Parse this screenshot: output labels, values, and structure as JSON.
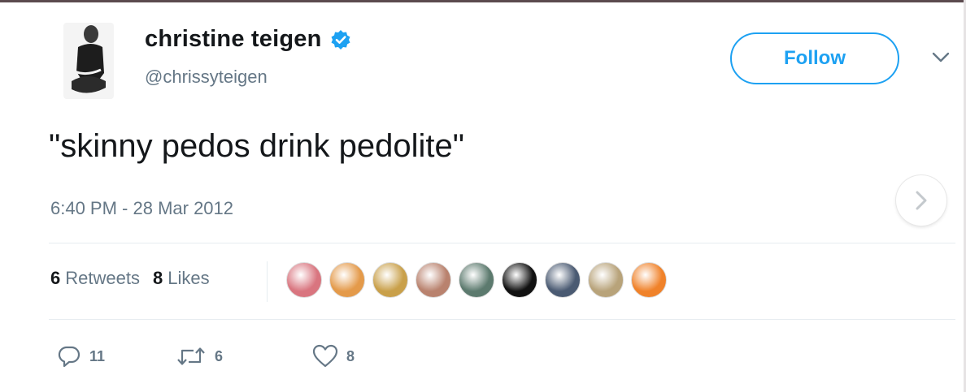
{
  "user": {
    "display_name": "christine teigen",
    "handle": "@chrissyteigen",
    "verified_icon": "verified-badge-icon"
  },
  "follow_button": {
    "label": "Follow"
  },
  "tweet": {
    "text": "\"skinny pedos drink pedolite\"",
    "timestamp": "6:40 PM - 28 Mar 2012"
  },
  "stats": {
    "retweets": {
      "count": "6",
      "label": "Retweets"
    },
    "likes": {
      "count": "8",
      "label": "Likes"
    }
  },
  "liker_avatars": [
    {
      "name": "liker-avatar-1",
      "color": "#d9757f"
    },
    {
      "name": "liker-avatar-2",
      "color": "#e49a4a"
    },
    {
      "name": "liker-avatar-3",
      "color": "#c9a04a"
    },
    {
      "name": "liker-avatar-4",
      "color": "#b9826e"
    },
    {
      "name": "liker-avatar-5",
      "color": "#5c7a6e"
    },
    {
      "name": "liker-avatar-6",
      "color": "#111111"
    },
    {
      "name": "liker-avatar-7",
      "color": "#4a5a72"
    },
    {
      "name": "liker-avatar-8",
      "color": "#b8a37a"
    },
    {
      "name": "liker-avatar-9",
      "color": "#f0822a"
    }
  ],
  "actions": {
    "reply": {
      "icon": "reply-icon",
      "count": "11"
    },
    "retweet": {
      "icon": "retweet-icon",
      "count": "6"
    },
    "like": {
      "icon": "heart-icon",
      "count": "8"
    }
  },
  "colors": {
    "accent": "#1da1f2",
    "secondary_text": "#657786",
    "primary_text": "#14171a"
  }
}
